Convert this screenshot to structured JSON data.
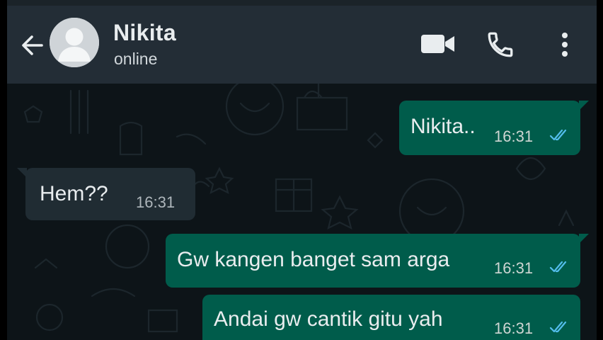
{
  "header": {
    "title": "Nikita",
    "status": "online",
    "icons": [
      "back-arrow-icon",
      "avatar-placeholder-icon",
      "video-call-icon",
      "voice-call-icon",
      "more-options-icon"
    ]
  },
  "colors": {
    "header_bg": "#232d36",
    "chat_bg": "#0d1418",
    "outgoing_bubble": "#005c4b",
    "incoming_bubble": "#202c33",
    "read_ticks": "#53bdeb"
  },
  "messages": [
    {
      "direction": "outgoing",
      "text": "Nikita..",
      "time": "16:31",
      "status": "read"
    },
    {
      "direction": "incoming",
      "text": "Hem??",
      "time": "16:31"
    },
    {
      "direction": "outgoing",
      "text": "Gw kangen banget sam arga",
      "time": "16:31",
      "status": "read"
    },
    {
      "direction": "outgoing",
      "text": "Andai gw cantik gitu yah",
      "time": "16:31",
      "status": "read"
    }
  ]
}
